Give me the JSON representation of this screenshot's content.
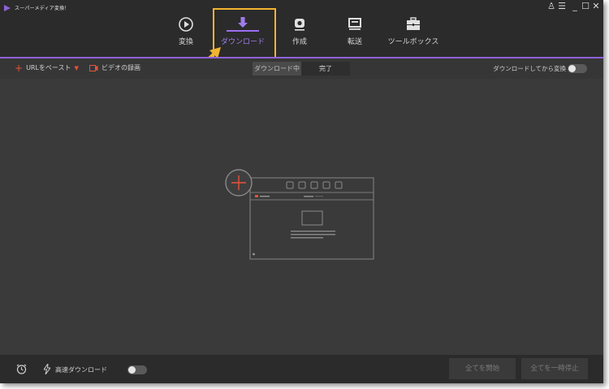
{
  "app": {
    "title": "スーパーメディア変換！"
  },
  "window_controls": {
    "user": "♙",
    "menu": "☰",
    "minimize": "_",
    "maximize": "☐",
    "close": "✕"
  },
  "nav": {
    "items": [
      {
        "label": "変換",
        "icon": "play-circle-icon",
        "active": false
      },
      {
        "label": "ダウンロード",
        "icon": "download-arrow-icon",
        "active": true
      },
      {
        "label": "作成",
        "icon": "disc-burn-icon",
        "active": false
      },
      {
        "label": "転送",
        "icon": "transfer-icon",
        "active": false
      },
      {
        "label": "ツールボックス",
        "icon": "toolbox-icon",
        "active": false
      }
    ]
  },
  "toolbar": {
    "paste_url": "URLをペースト",
    "record_video": "ビデオの録画",
    "tabs": [
      {
        "label": "ダウンロード中"
      },
      {
        "label": "完了"
      }
    ],
    "convert_after_download": "ダウンロードしてから変換",
    "convert_after_download_on": false
  },
  "bottom": {
    "high_speed_download": "高速ダウンロード",
    "high_speed_on": false,
    "start_all": "全てを開始",
    "pause_all": "全てを一時停止"
  },
  "colors": {
    "accent": "#9b6ef0",
    "highlight": "#f2b531",
    "red": "#e8523b"
  }
}
